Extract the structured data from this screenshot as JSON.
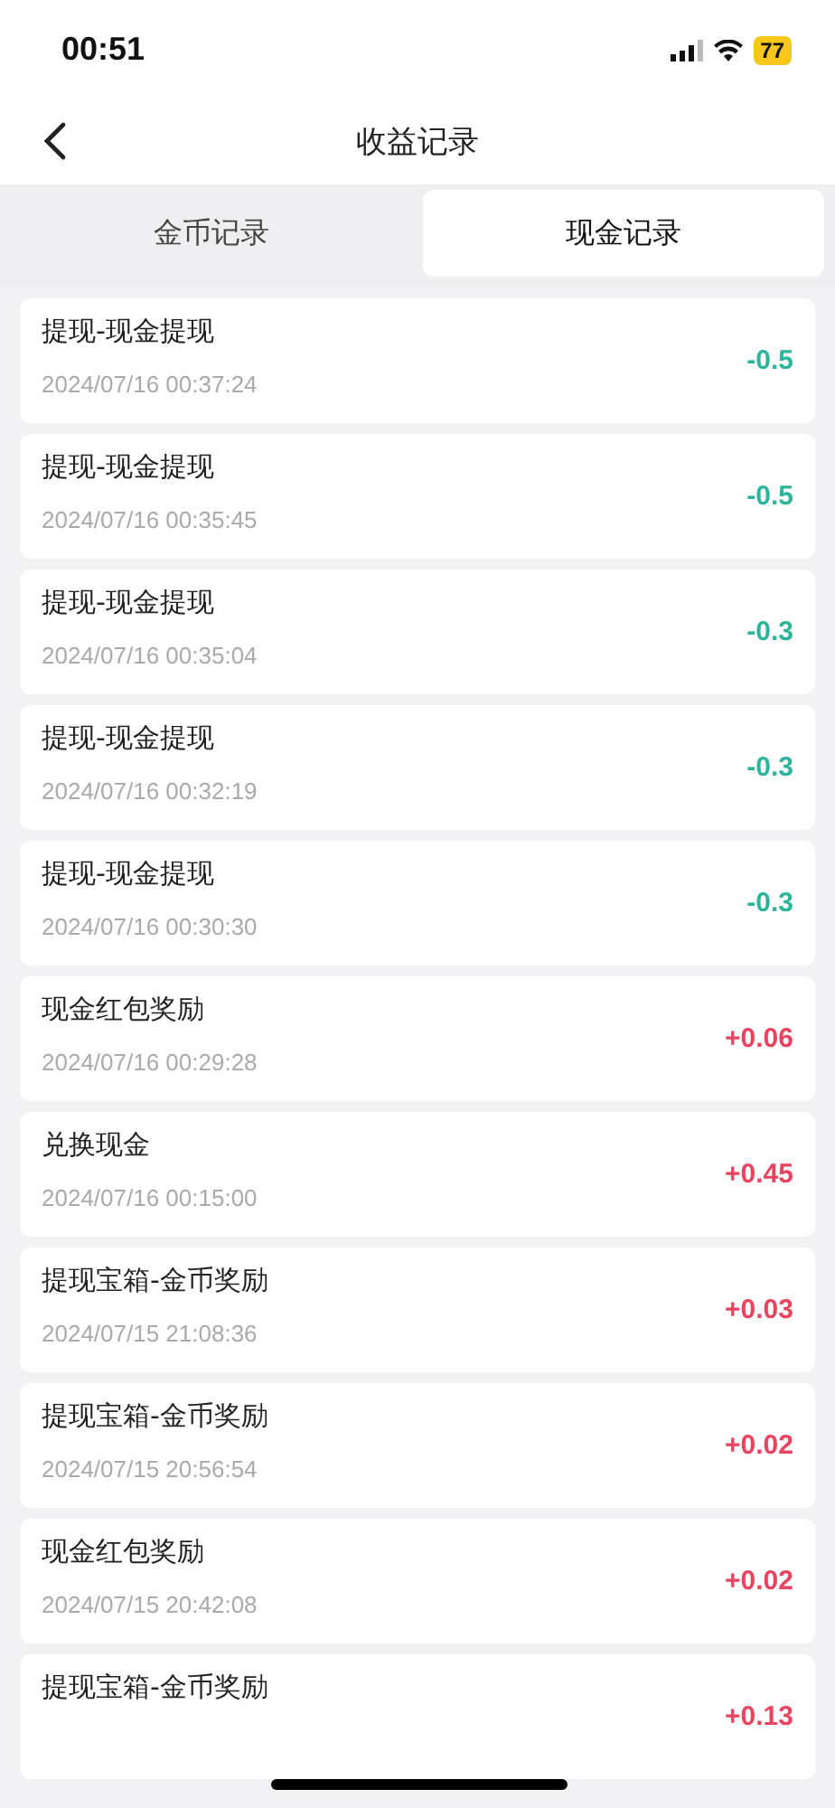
{
  "status_bar": {
    "time": "00:51",
    "battery": "77"
  },
  "nav": {
    "title": "收益记录"
  },
  "tabs": [
    {
      "label": "金币记录",
      "selected": false
    },
    {
      "label": "现金记录",
      "selected": true
    }
  ],
  "records": [
    {
      "title": "提现-现金提现",
      "date": "2024/07/16 00:37:24",
      "amount": "-0.5",
      "kind": "debit"
    },
    {
      "title": "提现-现金提现",
      "date": "2024/07/16 00:35:45",
      "amount": "-0.5",
      "kind": "debit"
    },
    {
      "title": "提现-现金提现",
      "date": "2024/07/16 00:35:04",
      "amount": "-0.3",
      "kind": "debit"
    },
    {
      "title": "提现-现金提现",
      "date": "2024/07/16 00:32:19",
      "amount": "-0.3",
      "kind": "debit"
    },
    {
      "title": "提现-现金提现",
      "date": "2024/07/16 00:30:30",
      "amount": "-0.3",
      "kind": "debit"
    },
    {
      "title": "现金红包奖励",
      "date": "2024/07/16 00:29:28",
      "amount": "+0.06",
      "kind": "credit"
    },
    {
      "title": "兑换现金",
      "date": "2024/07/16 00:15:00",
      "amount": "+0.45",
      "kind": "credit"
    },
    {
      "title": "提现宝箱-金币奖励",
      "date": "2024/07/15 21:08:36",
      "amount": "+0.03",
      "kind": "credit"
    },
    {
      "title": "提现宝箱-金币奖励",
      "date": "2024/07/15 20:56:54",
      "amount": "+0.02",
      "kind": "credit"
    },
    {
      "title": "现金红包奖励",
      "date": "2024/07/15 20:42:08",
      "amount": "+0.02",
      "kind": "credit"
    },
    {
      "title": "提现宝箱-金币奖励",
      "amount": "+0.13",
      "kind": "credit"
    }
  ]
}
